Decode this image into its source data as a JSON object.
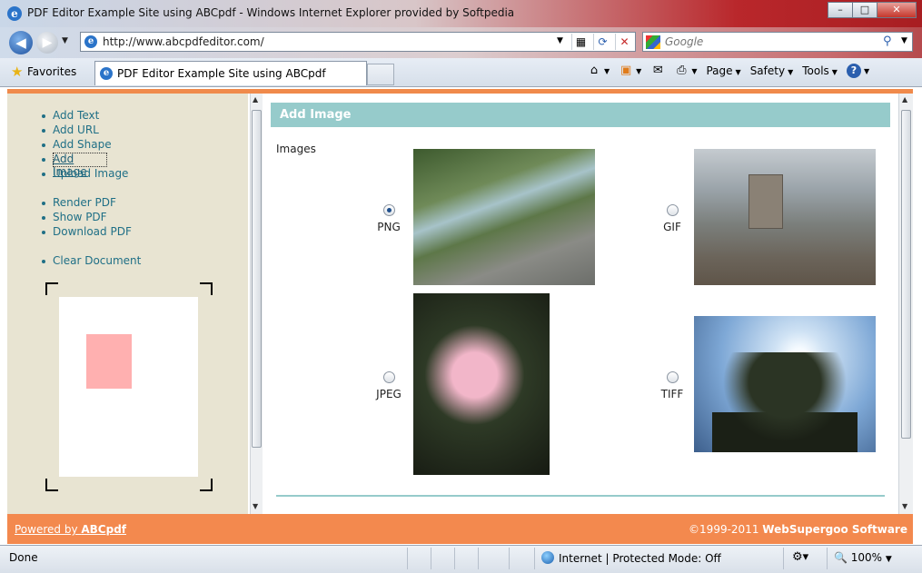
{
  "window": {
    "title": "PDF Editor Example Site using ABCpdf - Windows Internet Explorer provided by Softpedia",
    "controls": [
      "–",
      "□",
      "✕"
    ]
  },
  "address_bar": {
    "url": "http://www.abcpdfeditor.com/"
  },
  "search": {
    "placeholder": "Google"
  },
  "favorites": {
    "label": "Favorites"
  },
  "tab": {
    "title": "PDF Editor Example Site using ABCpdf"
  },
  "command_bar": {
    "page": "Page",
    "safety": "Safety",
    "tools": "Tools"
  },
  "sidebar": {
    "group1": [
      "Add Text",
      "Add URL",
      "Add Shape",
      "Add Image",
      "Upload Image"
    ],
    "group2": [
      "Render PDF",
      "Show PDF",
      "Download PDF"
    ],
    "group3": [
      "Clear Document"
    ],
    "selected": "Add Image",
    "shape_color": "#ffb0b0"
  },
  "main": {
    "section_title": "Add Image",
    "images_label": "Images",
    "options": [
      {
        "label": "PNG",
        "checked": true
      },
      {
        "label": "GIF",
        "checked": false
      },
      {
        "label": "JPEG",
        "checked": false
      },
      {
        "label": "TIFF",
        "checked": false
      }
    ]
  },
  "footer": {
    "powered_by_prefix": "Powered by ",
    "powered_by_brand": "ABCpdf",
    "copyright_prefix": "©1999-2011 ",
    "copyright_brand": "WebSupergoo Software",
    "color": "#f3894e"
  },
  "status": {
    "left": "Done",
    "zone": "Internet | Protected Mode: Off",
    "zoom": "100%"
  },
  "colors": {
    "accent": "#96cbcb",
    "orange": "#f08a4b",
    "link": "#1f6f86"
  }
}
